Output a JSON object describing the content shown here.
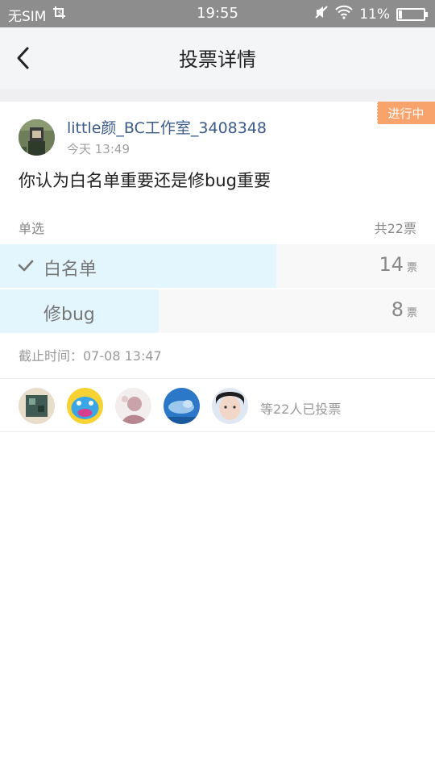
{
  "statusbar": {
    "carrier": "无SIM",
    "time": "19:55",
    "battery": "11%"
  },
  "header": {
    "title": "投票详情"
  },
  "post": {
    "status_tag": "进行中",
    "username": "little颜_BC工作室_3408348",
    "time": "今天 13:49",
    "question": "你认为白名单重要还是修bug重要"
  },
  "poll": {
    "mode": "单选",
    "total": "共22票",
    "options": [
      {
        "label": "白名单",
        "votes": "14",
        "unit": "票",
        "selected": true,
        "share": 0.636
      },
      {
        "label": "修bug",
        "votes": "8",
        "unit": "票",
        "selected": false,
        "share": 0.364
      }
    ],
    "deadline": "截止时间：07-08 13:47"
  },
  "voters": {
    "summary": "等22人已投票"
  },
  "colors": {
    "accent_tag": "#f7a36b",
    "bar_fill": "#e3f5fd",
    "username": "#3b5b8a"
  }
}
